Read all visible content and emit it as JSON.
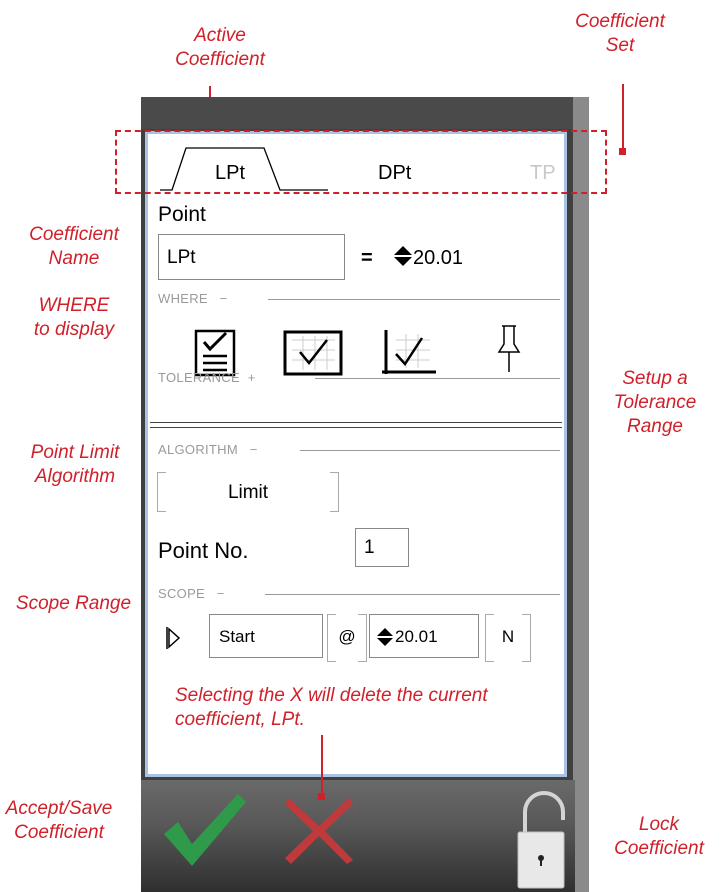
{
  "annotations": {
    "active_coefficient": [
      "Active",
      "Coefficient"
    ],
    "coefficient_set": [
      "Coefficient",
      "Set"
    ],
    "coefficient_name": [
      "Coefficient",
      "Name"
    ],
    "where_to_display": [
      "WHERE",
      "to display"
    ],
    "setup_tolerance": [
      "Setup a",
      "Tolerance",
      "Range"
    ],
    "point_limit_algorithm": [
      "Point Limit",
      "Algorithm"
    ],
    "scope_range": "Scope Range",
    "delete_note": [
      "Selecting the X will delete the current",
      "coefficient, LPt."
    ],
    "accept_save": [
      "Accept/Save",
      "Coefficient"
    ],
    "lock": [
      "Lock",
      "Coefficient"
    ]
  },
  "tabs": [
    {
      "label": "LPt",
      "active": true
    },
    {
      "label": "DPt",
      "active": false
    },
    {
      "label": "TP",
      "active": false
    }
  ],
  "point": {
    "heading": "Point",
    "name_value": "LPt",
    "equals": "=",
    "value": "20.01"
  },
  "where": {
    "label": "WHERE",
    "toggle": "−",
    "icons": [
      "checklist-icon",
      "checkbox-grid-icon",
      "chart-check-icon",
      "pushpin-icon"
    ]
  },
  "tolerance": {
    "label": "TOLERANCE",
    "toggle": "+"
  },
  "algorithm": {
    "label": "ALGORITHM",
    "toggle": "−",
    "value": "Limit",
    "point_no_label": "Point No.",
    "point_no_value": "1"
  },
  "scope": {
    "label": "SCOPE",
    "toggle": "−",
    "start": "Start",
    "at": "@",
    "value": "20.01",
    "n": "N"
  },
  "colors": {
    "annotation": "#d0202a",
    "panel_border": "#a9c4e2",
    "accept": "#2e9a4a",
    "delete": "#c0393b"
  }
}
